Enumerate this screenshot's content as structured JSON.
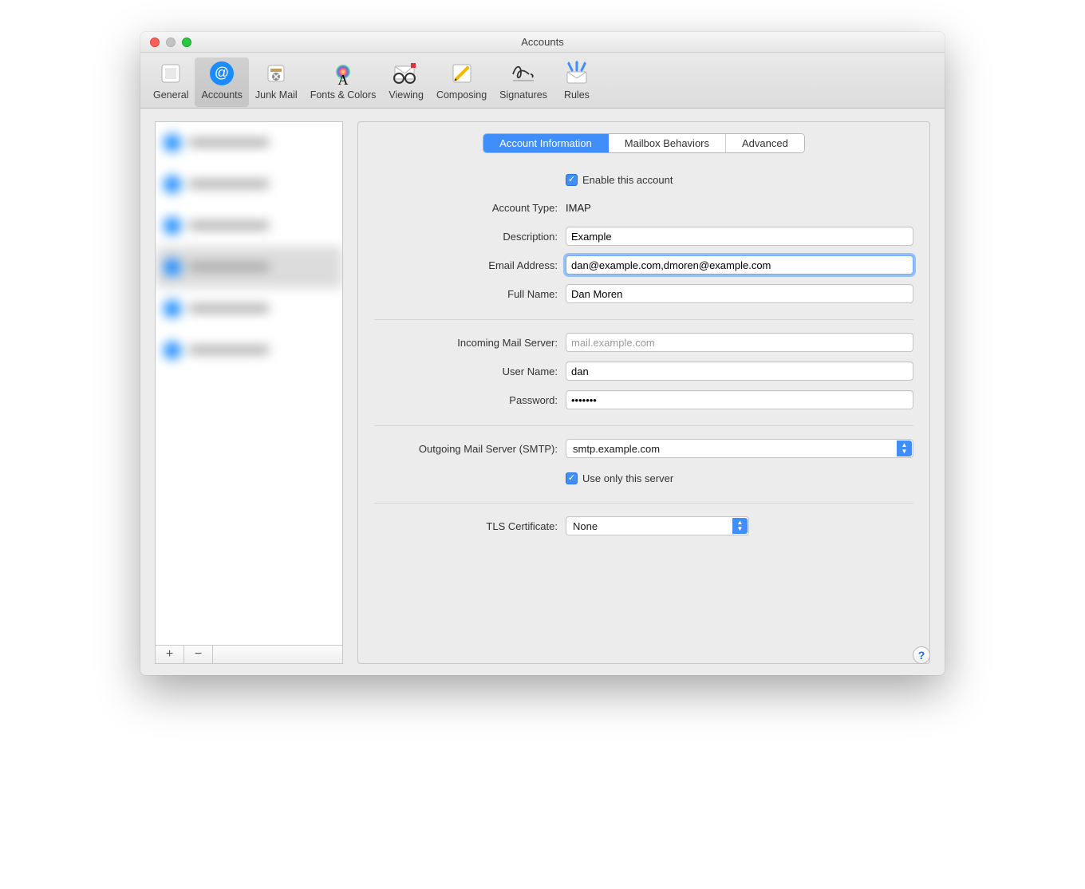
{
  "window": {
    "title": "Accounts"
  },
  "toolbar": [
    {
      "id": "general",
      "label": "General"
    },
    {
      "id": "accounts",
      "label": "Accounts"
    },
    {
      "id": "junk",
      "label": "Junk Mail"
    },
    {
      "id": "fonts",
      "label": "Fonts & Colors"
    },
    {
      "id": "viewing",
      "label": "Viewing"
    },
    {
      "id": "composing",
      "label": "Composing"
    },
    {
      "id": "signatures",
      "label": "Signatures"
    },
    {
      "id": "rules",
      "label": "Rules"
    }
  ],
  "toolbar_active": "accounts",
  "sidebar": {
    "add_symbol": "+",
    "remove_symbol": "−",
    "account_count": 6,
    "selected_index": 3
  },
  "tabs": {
    "info": "Account Information",
    "mailbox": "Mailbox Behaviors",
    "advanced": "Advanced",
    "active": "info"
  },
  "fields": {
    "enable_label": "Enable this account",
    "enable_checked": true,
    "account_type_label": "Account Type:",
    "account_type_value": "IMAP",
    "description_label": "Description:",
    "description_value": "Example",
    "email_label": "Email Address:",
    "email_value": "dan@example.com,dmoren@example.com",
    "fullname_label": "Full Name:",
    "fullname_value": "Dan Moren",
    "incoming_label": "Incoming Mail Server:",
    "incoming_value": "mail.example.com",
    "username_label": "User Name:",
    "username_value": "dan",
    "password_label": "Password:",
    "password_value": "•••••••",
    "smtp_label": "Outgoing Mail Server (SMTP):",
    "smtp_value": "smtp.example.com",
    "useonly_label": "Use only this server",
    "useonly_checked": true,
    "tls_label": "TLS Certificate:",
    "tls_value": "None"
  },
  "help": "?"
}
